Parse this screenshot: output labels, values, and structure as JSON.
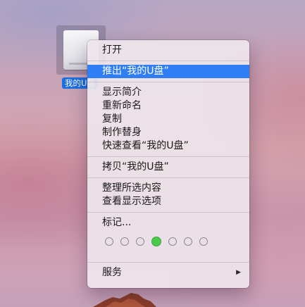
{
  "desktop": {
    "drive_label": "我的U盘"
  },
  "menu": {
    "open": "打开",
    "eject": "推出“我的U盘”",
    "get_info": "显示简介",
    "rename": "重新命名",
    "duplicate": "复制",
    "make_alias": "制作替身",
    "quick_look": "快速查看“我的U盘”",
    "copy": "拷贝“我的U盘”",
    "clean_up": "整理所选内容",
    "view_options": "查看显示选项",
    "tags_label": "标记...",
    "tag_colors": [
      "none",
      "none",
      "none",
      "green",
      "none",
      "none",
      "none"
    ],
    "services": "服务",
    "services_arrow": "▶"
  },
  "colors": {
    "highlight": "#2f7ef5",
    "selection_label": "#1a6fe0",
    "tag_green": "#4cc94c"
  }
}
